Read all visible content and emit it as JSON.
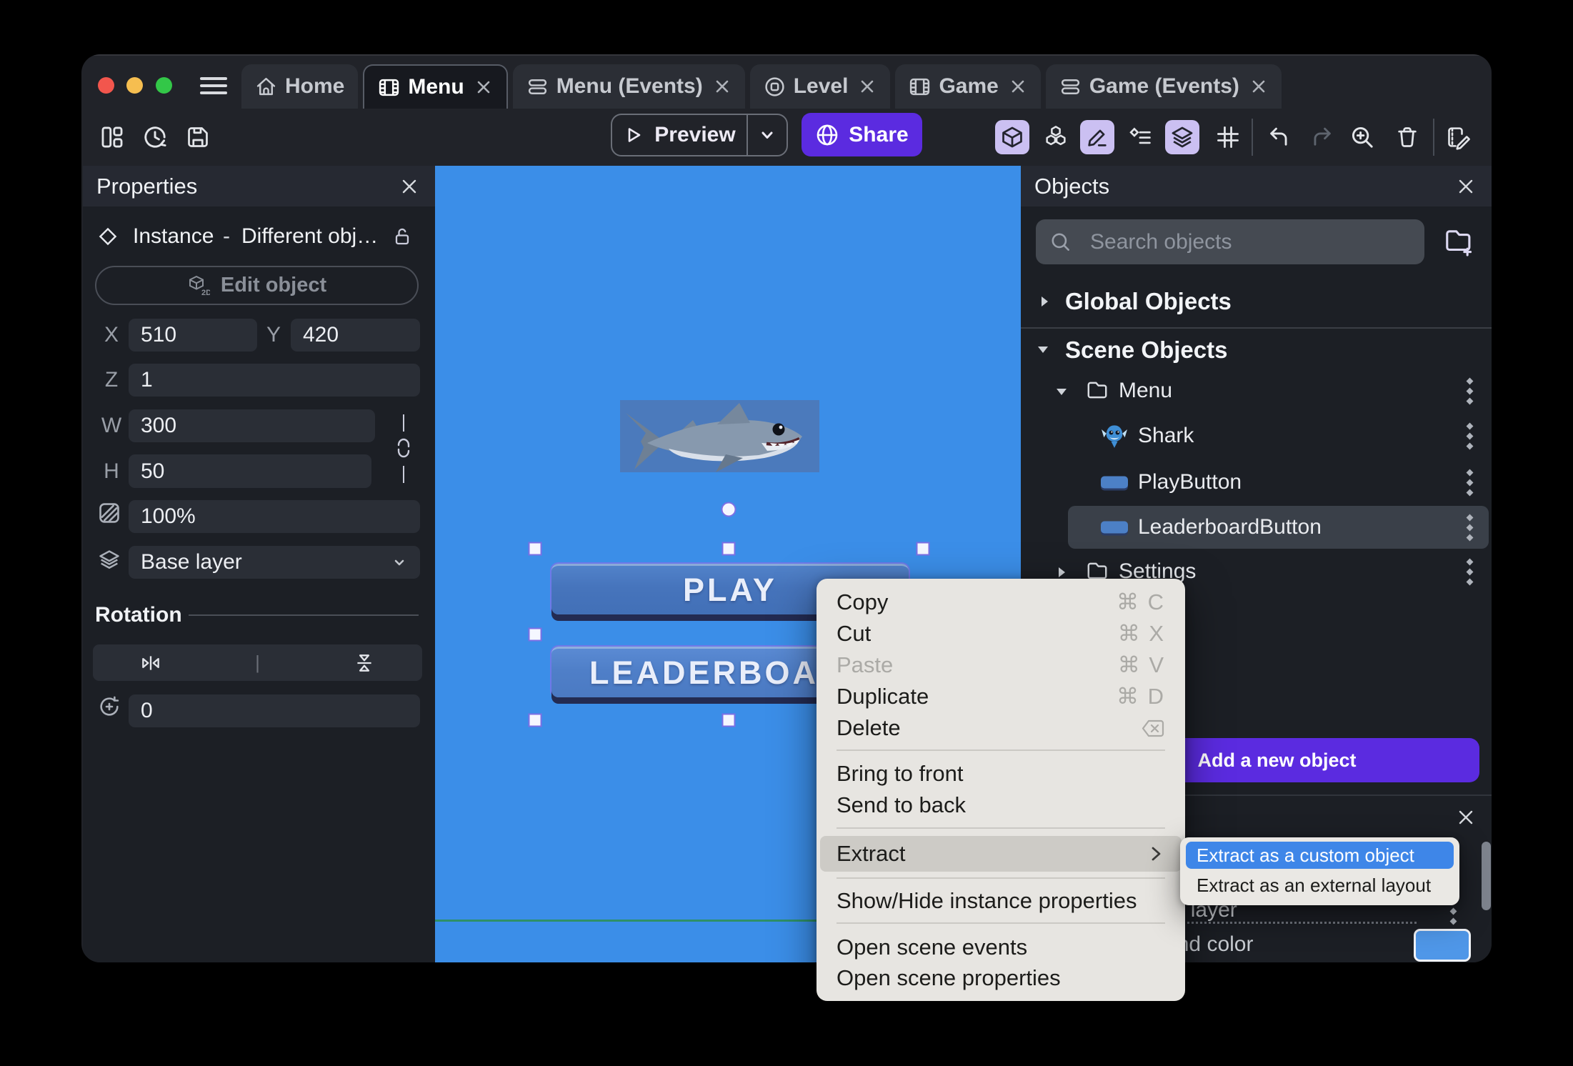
{
  "tabs": [
    {
      "label": "Home",
      "icon": "home-icon"
    },
    {
      "label": "Menu",
      "icon": "scene-icon",
      "active": true
    },
    {
      "label": "Menu (Events)",
      "icon": "events-icon"
    },
    {
      "label": "Level",
      "icon": "external-layout-icon"
    },
    {
      "label": "Game",
      "icon": "scene-icon"
    },
    {
      "label": "Game (Events)",
      "icon": "events-icon"
    }
  ],
  "toolbar": {
    "preview_label": "Preview",
    "share_label": "Share"
  },
  "properties_panel": {
    "title": "Properties",
    "instance_type": "Instance",
    "dash": "-",
    "instance_object": "Different obj…",
    "edit_object_label": "Edit object",
    "x_label": "X",
    "x_value": "510",
    "y_label": "Y",
    "y_value": "420",
    "z_label": "Z",
    "z_value": "1",
    "w_label": "W",
    "w_value": "300",
    "h_label": "H",
    "h_value": "50",
    "opacity_value": "100%",
    "layer_value": "Base layer",
    "rotation_title": "Rotation",
    "rotation_value": "0"
  },
  "canvas": {
    "play_button_label": "PLAY",
    "leaderboard_button_label": "LEADERBOARD"
  },
  "objects_panel": {
    "title": "Objects",
    "search_placeholder": "Search objects",
    "global_objects_label": "Global Objects",
    "scene_objects_label": "Scene Objects",
    "tree": [
      {
        "label": "Menu",
        "type": "folder",
        "expanded": true
      },
      {
        "label": "Shark",
        "type": "object"
      },
      {
        "label": "PlayButton",
        "type": "object"
      },
      {
        "label": "LeaderboardButton",
        "type": "object",
        "selected": true
      },
      {
        "label": "Settings",
        "type": "folder",
        "expanded": false
      }
    ],
    "add_button_label": "Add a new object"
  },
  "layers_panel": {
    "layer_name": "Base layer",
    "background_color_label": "Background color"
  },
  "context_menu": {
    "items": [
      {
        "label": "Copy",
        "shortcut": "⌘ C"
      },
      {
        "label": "Cut",
        "shortcut": "⌘ X"
      },
      {
        "label": "Paste",
        "shortcut": "⌘ V",
        "disabled": true
      },
      {
        "label": "Duplicate",
        "shortcut": "⌘ D"
      },
      {
        "label": "Delete",
        "icon": "delete-key-icon"
      },
      {
        "label": "Bring to front"
      },
      {
        "label": "Send to back"
      },
      {
        "label": "Extract",
        "highlighted": true,
        "has_submenu": true
      },
      {
        "label": "Show/Hide instance properties"
      },
      {
        "label": "Open scene events"
      },
      {
        "label": "Open scene properties"
      }
    ]
  },
  "submenu": {
    "items": [
      {
        "label": "Extract as a custom object",
        "highlighted": true
      },
      {
        "label": "Extract as an external layout"
      }
    ]
  },
  "colors": {
    "accent_purple": "#5B2BE0",
    "canvas_blue": "#3B8EE8",
    "selection_blue": "#3E86E8",
    "toolbar_highlight": "#CBC0F2",
    "scene_line_teal": "#2E9068",
    "background_swatch_blue": "#4F97E8"
  }
}
